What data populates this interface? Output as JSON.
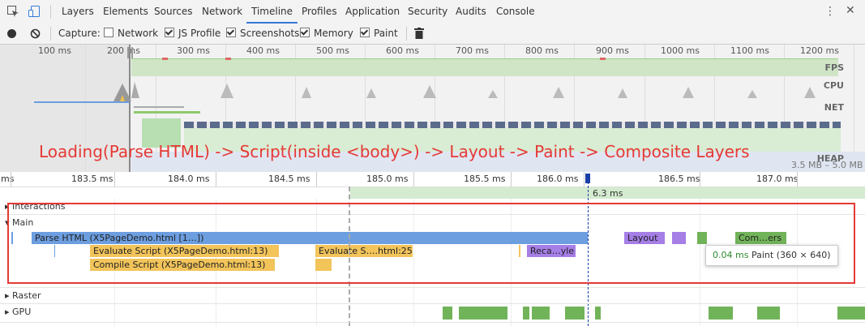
{
  "tabs": [
    "Layers",
    "Elements",
    "Sources",
    "Network",
    "Timeline",
    "Profiles",
    "Application",
    "Security",
    "Audits",
    "Console"
  ],
  "active_tab": "Timeline",
  "capture": {
    "label": "Capture:",
    "options": [
      {
        "label": "Network",
        "checked": false
      },
      {
        "label": "JS Profile",
        "checked": true
      },
      {
        "label": "Screenshots",
        "checked": true
      },
      {
        "label": "Memory",
        "checked": true
      },
      {
        "label": "Paint",
        "checked": true
      }
    ]
  },
  "overview": {
    "ticks": [
      "100 ms",
      "200 ms",
      "300 ms",
      "400 ms",
      "500 ms",
      "600 ms",
      "700 ms",
      "800 ms",
      "900 ms",
      "1000 ms",
      "1100 ms",
      "1200 ms"
    ],
    "tracks": [
      "FPS",
      "CPU",
      "NET",
      "HEAP"
    ],
    "heap_range": "3.5 MB – 5.0 MB",
    "annotation": "Loading(Parse HTML) -> Script(inside <body>) -> Layout -> Paint -> Composite Layers",
    "annotation_color": "#e53935"
  },
  "ruler": {
    "ticks": [
      "ms",
      "183.5 ms",
      "184.0 ms",
      "184.5 ms",
      "185.0 ms",
      "185.5 ms",
      "186.0 ms",
      "186.5 ms",
      "187.0 ms"
    ],
    "selection_label": "6.3 ms"
  },
  "rows": {
    "interactions": "Interactions",
    "main": "Main",
    "raster": "Raster",
    "gpu": "GPU"
  },
  "events": {
    "parse_html": "Parse HTML (X5PageDemo.html [1…])",
    "evaluate_script_1": "Evaluate Script (X5PageDemo.html:13)",
    "compile_script": "Compile Script (X5PageDemo.html:13)",
    "evaluate_script_2": "Evaluate S….html:25)",
    "recalc_style": "Reca…yle",
    "layout": "Layout",
    "composite": "Com…ers"
  },
  "tooltip": {
    "duration": "0.04 ms",
    "text": "Paint (360 × 640)"
  },
  "colors": {
    "loading": "#6c9ee0",
    "scripting": "#f2c45a",
    "rendering": "#a57ee6",
    "painting": "#71b359",
    "highlight_box": "#e53935",
    "selection": "#d4ebd0"
  }
}
